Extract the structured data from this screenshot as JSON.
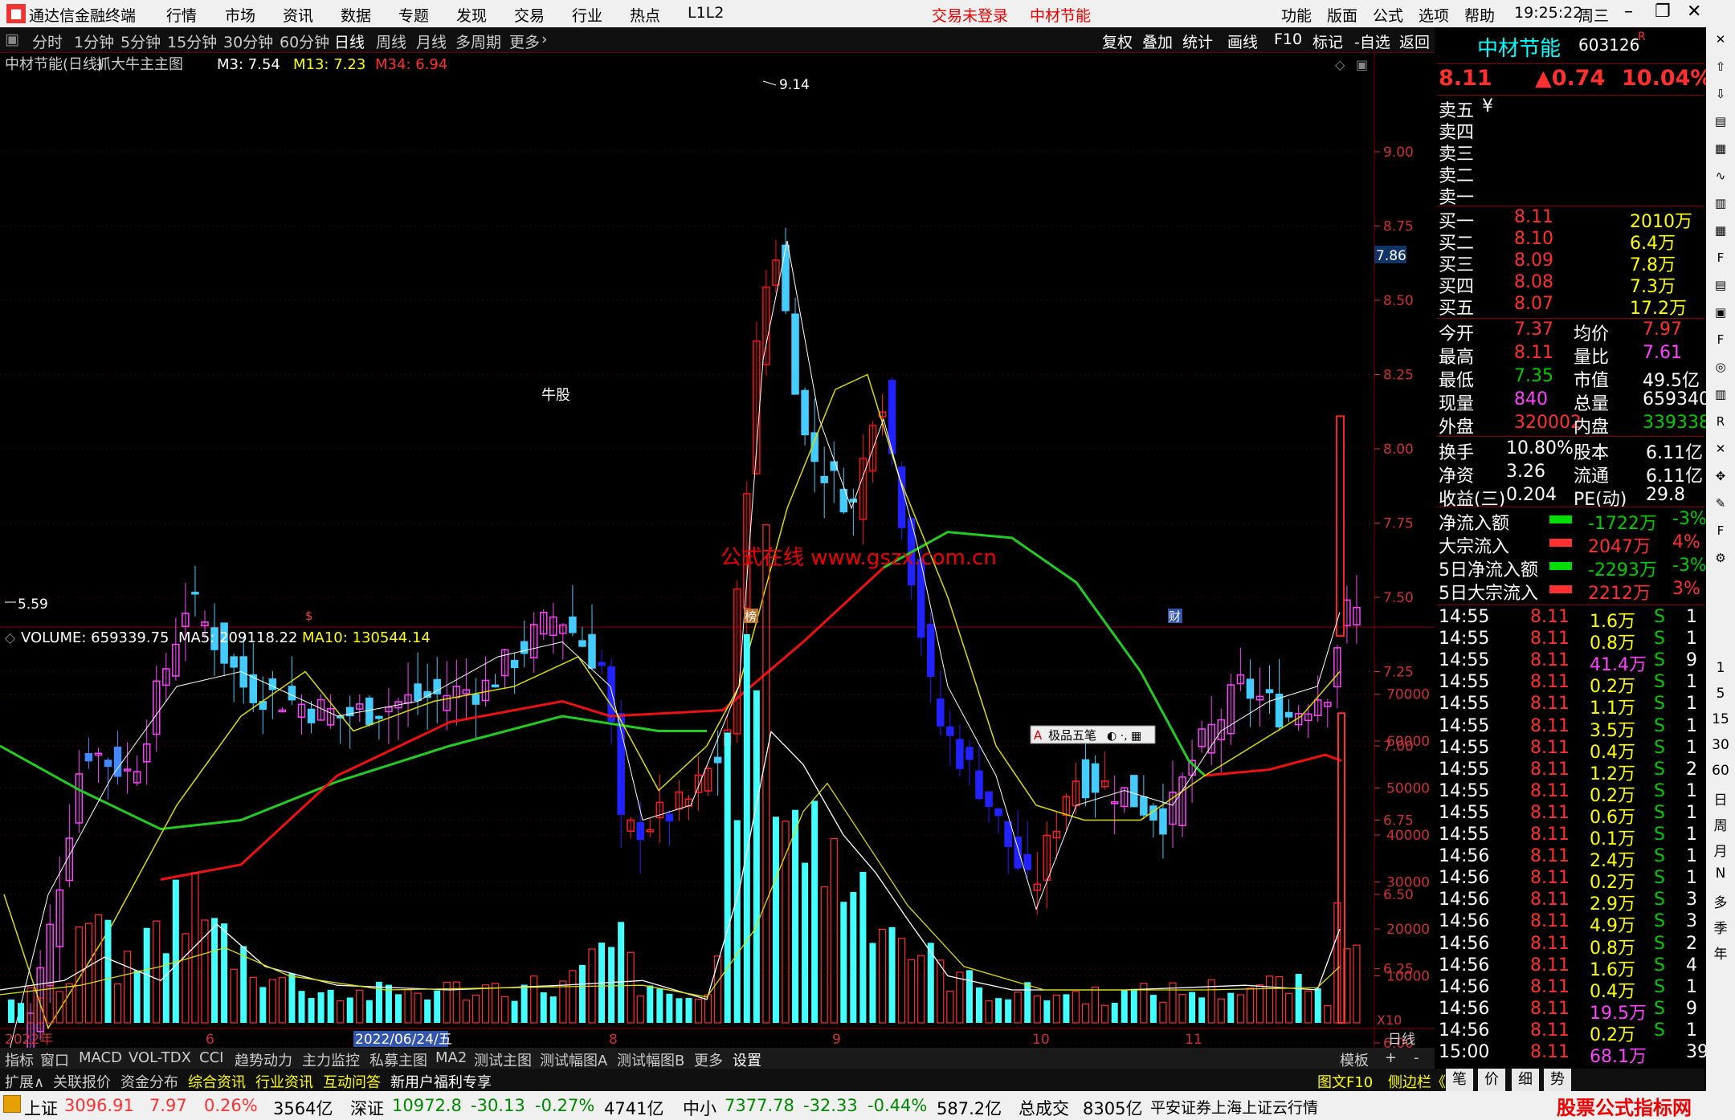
{
  "menubar": {
    "app_title": "通达信金融终端",
    "items": [
      "行情",
      "市场",
      "资讯",
      "数据",
      "专题",
      "发现",
      "交易",
      "行业",
      "热点",
      "L1L2"
    ],
    "login": "交易未登录",
    "stock_name": "中材节能",
    "right_items": [
      "功能",
      "版面",
      "公式",
      "选项",
      "帮助"
    ],
    "time": "19:25:22",
    "weekday": "周三"
  },
  "periodbar": {
    "items": [
      "分时",
      "1分钟",
      "5分钟",
      "15分钟",
      "30分钟",
      "60分钟",
      "日线",
      "周线",
      "月线",
      "多周期",
      "更多"
    ],
    "selected": "日线",
    "right_items": [
      "复权",
      "叠加",
      "统计",
      "画线",
      "F10",
      "标记",
      "-自选",
      "返回"
    ]
  },
  "main_chart": {
    "title": "中材节能(日线)",
    "indicator": "抓大牛主主图",
    "m3": "M3: 7.54",
    "m13": "M13: 7.23",
    "m34": "M34: 6.94",
    "high_label": "9.14",
    "low_label": "5.59",
    "annotation": "牛股",
    "watermark": "公式在线  www.gszx.com.cn",
    "current_price_tag": "7.86",
    "y_ticks": [
      "9.00",
      "8.75",
      "8.50",
      "8.25",
      "8.00",
      "7.75",
      "7.50",
      "7.25",
      "7.00",
      "6.75",
      "6.50",
      "6.25",
      "6.00"
    ],
    "markers": [
      "$",
      "榜",
      "财"
    ]
  },
  "volume_chart": {
    "title": "VOLUME: 659339.75",
    "ma5": "MA5: 209118.22",
    "ma10": "MA10: 130544.14",
    "y_ticks": [
      "70000",
      "60000",
      "50000",
      "40000",
      "30000",
      "20000",
      "10000"
    ],
    "unit": "X10",
    "popup": "极品五笔"
  },
  "date_axis": {
    "labels": [
      "2022年",
      "6",
      "2022/06/24/五",
      "8",
      "9",
      "10",
      "11"
    ],
    "right": "日线"
  },
  "quote": {
    "name": "中材节能",
    "code": "603126",
    "tag": "R",
    "price": "8.11",
    "change": "▲0.74",
    "pct": "10.04%",
    "sell": [
      {
        "label": "卖五",
        "mark": "¥"
      },
      {
        "label": "卖四"
      },
      {
        "label": "卖三"
      },
      {
        "label": "卖二"
      },
      {
        "label": "卖一"
      }
    ],
    "buy": [
      {
        "label": "买一",
        "price": "8.11",
        "vol": "2010万"
      },
      {
        "label": "买二",
        "price": "8.10",
        "vol": "6.4万"
      },
      {
        "label": "买三",
        "price": "8.09",
        "vol": "7.8万"
      },
      {
        "label": "买四",
        "price": "8.08",
        "vol": "7.3万"
      },
      {
        "label": "买五",
        "price": "8.07",
        "vol": "17.2万"
      }
    ],
    "stats": [
      [
        "今开",
        "7.37",
        "均价",
        "7.97"
      ],
      [
        "最高",
        "8.11",
        "量比",
        "7.61"
      ],
      [
        "最低",
        "7.35",
        "市值",
        "49.5亿"
      ],
      [
        "现量",
        "840",
        "总量",
        "659340"
      ],
      [
        "外盘",
        "320002",
        "内盘",
        "339338"
      ]
    ],
    "stats2": [
      [
        "换手",
        "10.80%",
        "股本",
        "6.11亿"
      ],
      [
        "净资",
        "3.26",
        "流通",
        "6.11亿"
      ],
      [
        "收益(三)",
        "0.204",
        "PE(动)",
        "29.8"
      ]
    ],
    "flows": [
      [
        "净流入额",
        "-1722万",
        "-3%"
      ],
      [
        "大宗流入",
        "2047万",
        "4%"
      ],
      [
        "5日净流入额",
        "-2293万",
        "-3%"
      ],
      [
        "5日大宗流入",
        "2212万",
        "3%"
      ]
    ],
    "ticks": [
      [
        "14:55",
        "8.11",
        "1.6万",
        "S",
        "1"
      ],
      [
        "14:55",
        "8.11",
        "0.8万",
        "S",
        "1"
      ],
      [
        "14:55",
        "8.11",
        "41.4万",
        "S",
        "9"
      ],
      [
        "14:55",
        "8.11",
        "0.2万",
        "S",
        "1"
      ],
      [
        "14:55",
        "8.11",
        "1.1万",
        "S",
        "1"
      ],
      [
        "14:55",
        "8.11",
        "3.5万",
        "S",
        "1"
      ],
      [
        "14:55",
        "8.11",
        "0.4万",
        "S",
        "1"
      ],
      [
        "14:55",
        "8.11",
        "1.2万",
        "S",
        "2"
      ],
      [
        "14:55",
        "8.11",
        "0.2万",
        "S",
        "1"
      ],
      [
        "14:55",
        "8.11",
        "0.6万",
        "S",
        "1"
      ],
      [
        "14:55",
        "8.11",
        "0.1万",
        "S",
        "1"
      ],
      [
        "14:56",
        "8.11",
        "2.4万",
        "S",
        "1"
      ],
      [
        "14:56",
        "8.11",
        "0.2万",
        "S",
        "1"
      ],
      [
        "14:56",
        "8.11",
        "2.9万",
        "S",
        "3"
      ],
      [
        "14:56",
        "8.11",
        "4.9万",
        "S",
        "3"
      ],
      [
        "14:56",
        "8.11",
        "0.8万",
        "S",
        "2"
      ],
      [
        "14:56",
        "8.11",
        "1.6万",
        "S",
        "4"
      ],
      [
        "14:56",
        "8.11",
        "0.4万",
        "S",
        "1"
      ],
      [
        "14:56",
        "8.11",
        "19.5万",
        "S",
        "9"
      ],
      [
        "14:56",
        "8.11",
        "0.2万",
        "S",
        "1"
      ],
      [
        "15:00",
        "8.11",
        "68.1万",
        "",
        "39"
      ]
    ]
  },
  "sidebar": [
    "1",
    "5",
    "15",
    "30",
    "60",
    "日",
    "周",
    "月",
    "N",
    "多",
    "季",
    "年"
  ],
  "tabbar1": {
    "items": [
      "指标",
      "窗口",
      "MACD",
      "VOL-TDX",
      "CCI",
      "趋势动力",
      "主力监控",
      "私募主图",
      "MA2",
      "测试主图",
      "测试幅图A",
      "测试幅图B",
      "更多",
      "设置"
    ],
    "right": [
      "模板",
      "+",
      "-"
    ]
  },
  "tabbar2": {
    "items": [
      "扩展∧",
      "关联报价",
      "资金分布",
      "综合资讯",
      "行业资讯",
      "互动问答",
      "新用户福利专享"
    ],
    "right": [
      "图文F10",
      "侧边栏《",
      "笔",
      "价",
      "细",
      "势"
    ]
  },
  "statusbar": {
    "sh_label": "上证",
    "sh": "3096.91",
    "sh_chg": "7.97",
    "sh_pct": "0.26%",
    "sh_amt": "3564亿",
    "sz_label": "深证",
    "sz": "10972.8",
    "sz_chg": "-30.13",
    "sz_pct": "-0.27%",
    "sz_amt": "4741亿",
    "zx_label": "中小",
    "zx": "7377.78",
    "zx_chg": "-32.33",
    "zx_pct": "-0.44%",
    "zx_amt": "587.2亿",
    "total_label": "总成交",
    "total": "8305亿",
    "broker": "平安证券上海上证云行情",
    "brand": "股票公式指标网",
    "brand_url": "www.gszx.com.cn"
  }
}
